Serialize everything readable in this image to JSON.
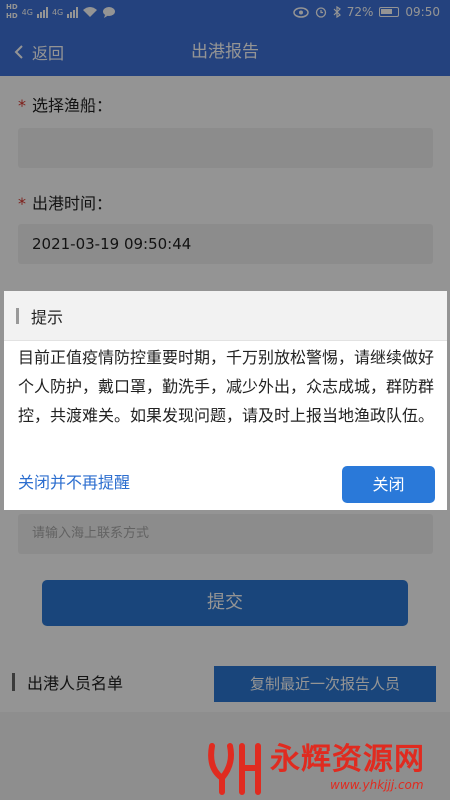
{
  "status_bar": {
    "left_top": "HD",
    "left_bottom": "HD",
    "signal_1": "4G",
    "signal_2": "4G",
    "battery": "72%",
    "time": "09:50"
  },
  "nav": {
    "back_label": "返回",
    "title": "出港报告"
  },
  "form": {
    "vessel_label": "选择渔船：",
    "vessel_value": "",
    "departure_label": "出港时间：",
    "departure_value": "2021-03-19 09:50:44",
    "contact_placeholder": "请输入海上联系方式",
    "required_mark": "*",
    "submit_label": "提交",
    "crew_list_label": "出港人员名单",
    "copy_button_label": "复制最近一次报告人员"
  },
  "dialog": {
    "title": "提示",
    "message": "目前正值疫情防控重要时期，千万别放松警惕，请继续做好个人防护，戴口罩，勤洗手，减少外出，众志成城，群防群控，共渡难关。如果发现问题，请及时上报当地渔政队伍。",
    "dismiss_forever_label": "关闭并不再提醒",
    "close_label": "关闭"
  },
  "watermark": {
    "name": "永辉资源网",
    "url": "www.yhkjjj.com"
  },
  "colors": {
    "header": "#3f73d9",
    "primary_button": "#2c78d4",
    "link": "#2c6ecf",
    "required": "#d9342b",
    "watermark": "#e02b20"
  },
  "icons": {
    "back": "chevron-left-icon",
    "watermark_logo": "yh-logo-icon"
  }
}
